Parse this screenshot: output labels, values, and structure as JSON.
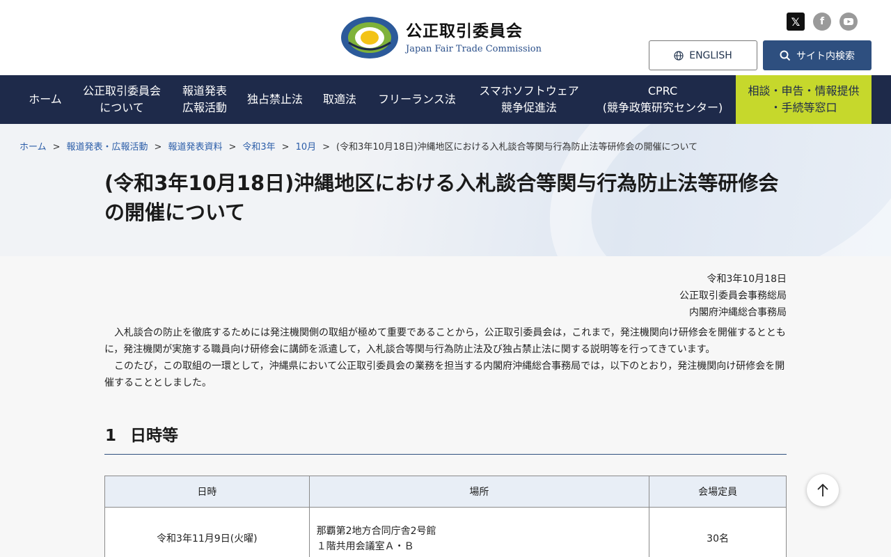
{
  "header": {
    "logo_jp": "公正取引委員会",
    "logo_en": "Japan Fair Trade Commission",
    "logo_ring_text": "JAPAN FAIR TRADE COMMISSION",
    "english_label": "ENGLISH",
    "search_label": "サイト内検索",
    "social": [
      "x-icon",
      "facebook-icon",
      "youtube-icon"
    ]
  },
  "nav": [
    {
      "line1": "ホーム",
      "line2": ""
    },
    {
      "line1": "公正取引委員会",
      "line2": "について"
    },
    {
      "line1": "報道発表",
      "line2": "広報活動"
    },
    {
      "line1": "独占禁止法",
      "line2": ""
    },
    {
      "line1": "取適法",
      "line2": ""
    },
    {
      "line1": "フリーランス法",
      "line2": ""
    },
    {
      "line1": "スマホソフトウェア",
      "line2": "競争促進法"
    },
    {
      "line1": "CPRC",
      "line2": "(競争政策研究センター)"
    },
    {
      "line1": "相談・申告・情報提供",
      "line2": "・手続等窓口"
    }
  ],
  "breadcrumb": {
    "links": [
      "ホーム",
      "報道発表・広報活動",
      "報道発表資料",
      "令和3年",
      "10月"
    ],
    "current": "(令和3年10月18日)沖縄地区における入札談合等関与行為防止法等研修会の開催について",
    "separator": ">"
  },
  "page_title": "(令和3年10月18日)沖縄地区における入札談合等関与行為防止法等研修会の開催について",
  "meta": {
    "date": "令和3年10月18日",
    "org1": "公正取引委員会事務総局",
    "org2": "内閣府沖縄総合事務局"
  },
  "paragraphs": [
    "入札談合の防止を徹底するためには発注機関側の取組が極めて重要であることから，公正取引委員会は，これまで，発注機関向け研修会を開催するとともに，発注機関が実施する職員向け研修会に講師を派遣して，入札談合等関与行為防止法及び独占禁止法に関する説明等を行ってきています。",
    "このたび，この取組の一環として，沖縄県において公正取引委員会の業務を担当する内閣府沖縄総合事務局では，以下のとおり，発注機関向け研修会を開催することとしました。"
  ],
  "section1": {
    "number": "1",
    "title": "日時等"
  },
  "table": {
    "headers": [
      "日時",
      "場所",
      "会場定員"
    ],
    "row": {
      "datetime": "令和3年11月9日(火曜)",
      "place_line1": "那覇第2地方合同庁舎2号館",
      "place_line2": "１階共用会議室Ａ・Ｂ",
      "capacity": "30名"
    }
  },
  "to_top_icon": "arrow-up-icon"
}
